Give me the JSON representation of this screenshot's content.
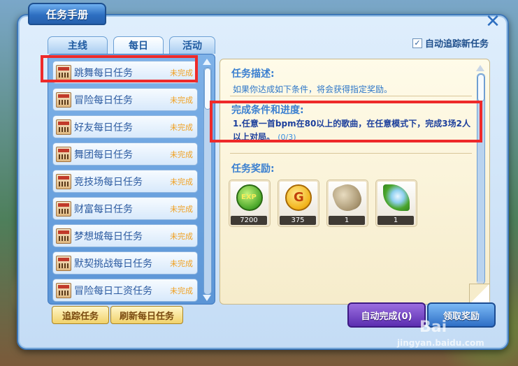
{
  "window": {
    "title": "任务手册"
  },
  "tabs": [
    {
      "label": "主线"
    },
    {
      "label": "每日",
      "active": true
    },
    {
      "label": "活动"
    }
  ],
  "auto_track": {
    "checked": true,
    "label": "自动追踪新任务"
  },
  "tasks": [
    {
      "name": "跳舞每日任务",
      "status": "未完成",
      "selected": true
    },
    {
      "name": "冒险每日任务",
      "status": "未完成"
    },
    {
      "name": "好友每日任务",
      "status": "未完成"
    },
    {
      "name": "舞团每日任务",
      "status": "未完成"
    },
    {
      "name": "竞技场每日任务",
      "status": "未完成"
    },
    {
      "name": "财富每日任务",
      "status": "未完成"
    },
    {
      "name": "梦想城每日任务",
      "status": "未完成"
    },
    {
      "name": "默契挑战每日任务",
      "status": "未完成"
    },
    {
      "name": "冒险每日工资任务",
      "status": "未完成"
    }
  ],
  "detail": {
    "desc_title": "任务描述:",
    "desc_text": "如果你达成如下条件，将会获得指定奖励。",
    "cond_title": "完成条件和进度:",
    "cond_index": "1.",
    "cond_text": "任意一首bpm在80以上的歌曲，在任意模式下，完成3场2人以上对局。",
    "cond_progress": "(0/3)",
    "reward_title": "任务奖励:",
    "rewards": [
      {
        "icon": "exp-orb-icon",
        "art_text": "EXP",
        "count": "7200"
      },
      {
        "icon": "gold-coin-icon",
        "art_text": "G",
        "count": "375"
      },
      {
        "icon": "item-bag-icon",
        "count": "1"
      },
      {
        "icon": "leaf-item-icon",
        "count": "1"
      }
    ]
  },
  "buttons": {
    "track": "追踪任务",
    "refresh": "刷新每日任务",
    "auto_complete": "自动完成(0)",
    "receive": "领取奖励"
  },
  "watermark": {
    "logo": "Bai",
    "site": "jingyan.baidu.com"
  },
  "colors": {
    "highlight": "#ee2a2a",
    "status": "#f0a020",
    "accent": "#2d6fc0"
  }
}
